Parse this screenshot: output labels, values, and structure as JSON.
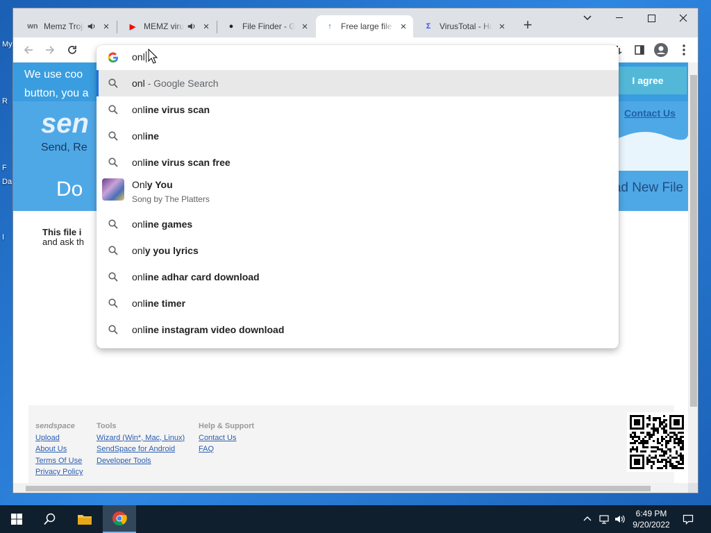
{
  "desktop": {
    "chars": [
      "My",
      "R",
      "F",
      "Da",
      "I"
    ]
  },
  "tabs": [
    {
      "title": "Memz Trojan",
      "favicon_text": "wn",
      "favicon_color": "#5f6368",
      "muted": true,
      "active": false
    },
    {
      "title": "MEMZ virus",
      "favicon_text": "▶",
      "favicon_color": "#ff0000",
      "muted": true,
      "active": false
    },
    {
      "title": "File Finder - GitHub",
      "favicon_text": "●",
      "favicon_color": "#202124",
      "muted": false,
      "active": false
    },
    {
      "title": "Free large file hosting",
      "favicon_text": "↑",
      "favicon_color": "#1a73e8",
      "muted": false,
      "active": true
    },
    {
      "title": "VirusTotal - Home",
      "favicon_text": "Σ",
      "favicon_color": "#394eff",
      "muted": false,
      "active": false
    }
  ],
  "omnibox": {
    "text": "onl",
    "suggestions": [
      {
        "typed": "onl",
        "completion": "",
        "suffix": " - Google Search",
        "icon": "search-icon",
        "selected": true
      },
      {
        "typed": "onl",
        "completion": "ine virus scan",
        "icon": "search-icon"
      },
      {
        "typed": "onl",
        "completion": "ine",
        "icon": "search-icon"
      },
      {
        "typed": "onl",
        "completion": "ine virus scan free",
        "icon": "search-icon"
      },
      {
        "typed": "Onl",
        "completion": "y You",
        "subtitle": "Song by The Platters",
        "icon": "album-art-thumbnail"
      },
      {
        "typed": "onl",
        "completion": "ine games",
        "icon": "search-icon"
      },
      {
        "typed": "onl",
        "completion": "y you lyrics",
        "icon": "search-icon"
      },
      {
        "typed": "onl",
        "completion": "ine adhar card download",
        "icon": "search-icon"
      },
      {
        "typed": "onl",
        "completion": "ine timer",
        "icon": "search-icon"
      },
      {
        "typed": "onl",
        "completion": "ine instagram video download",
        "icon": "search-icon"
      }
    ]
  },
  "page": {
    "cookie_line1": "We use coo",
    "cookie_line2": "button, you a",
    "agree_label": "I agree",
    "hero_brand": "sen",
    "hero_tagline": "Send, Re",
    "contact_label": "Contact Us",
    "download_big": "Do",
    "upload_new": "load New File",
    "info_bold": "This file i",
    "info_rest": "and ask th"
  },
  "footer": {
    "brand": "sendspace",
    "brand_links": [
      "Upload",
      "About Us",
      "Terms Of Use",
      "Privacy Policy"
    ],
    "tools_head": "Tools",
    "tools_links": [
      "Wizard (Win*, Mac, Linux)",
      "SendSpace for Android",
      "Developer Tools"
    ],
    "help_head": "Help & Support",
    "help_links": [
      "Contact Us",
      "FAQ"
    ]
  },
  "clock": {
    "time": "6:49 PM",
    "date": "9/20/2022"
  },
  "colors": {
    "accent": "#1a73e8",
    "cookie_bar": "#3a9de0",
    "hero": "#4fa8e6",
    "taskbar": "#101f2e"
  }
}
